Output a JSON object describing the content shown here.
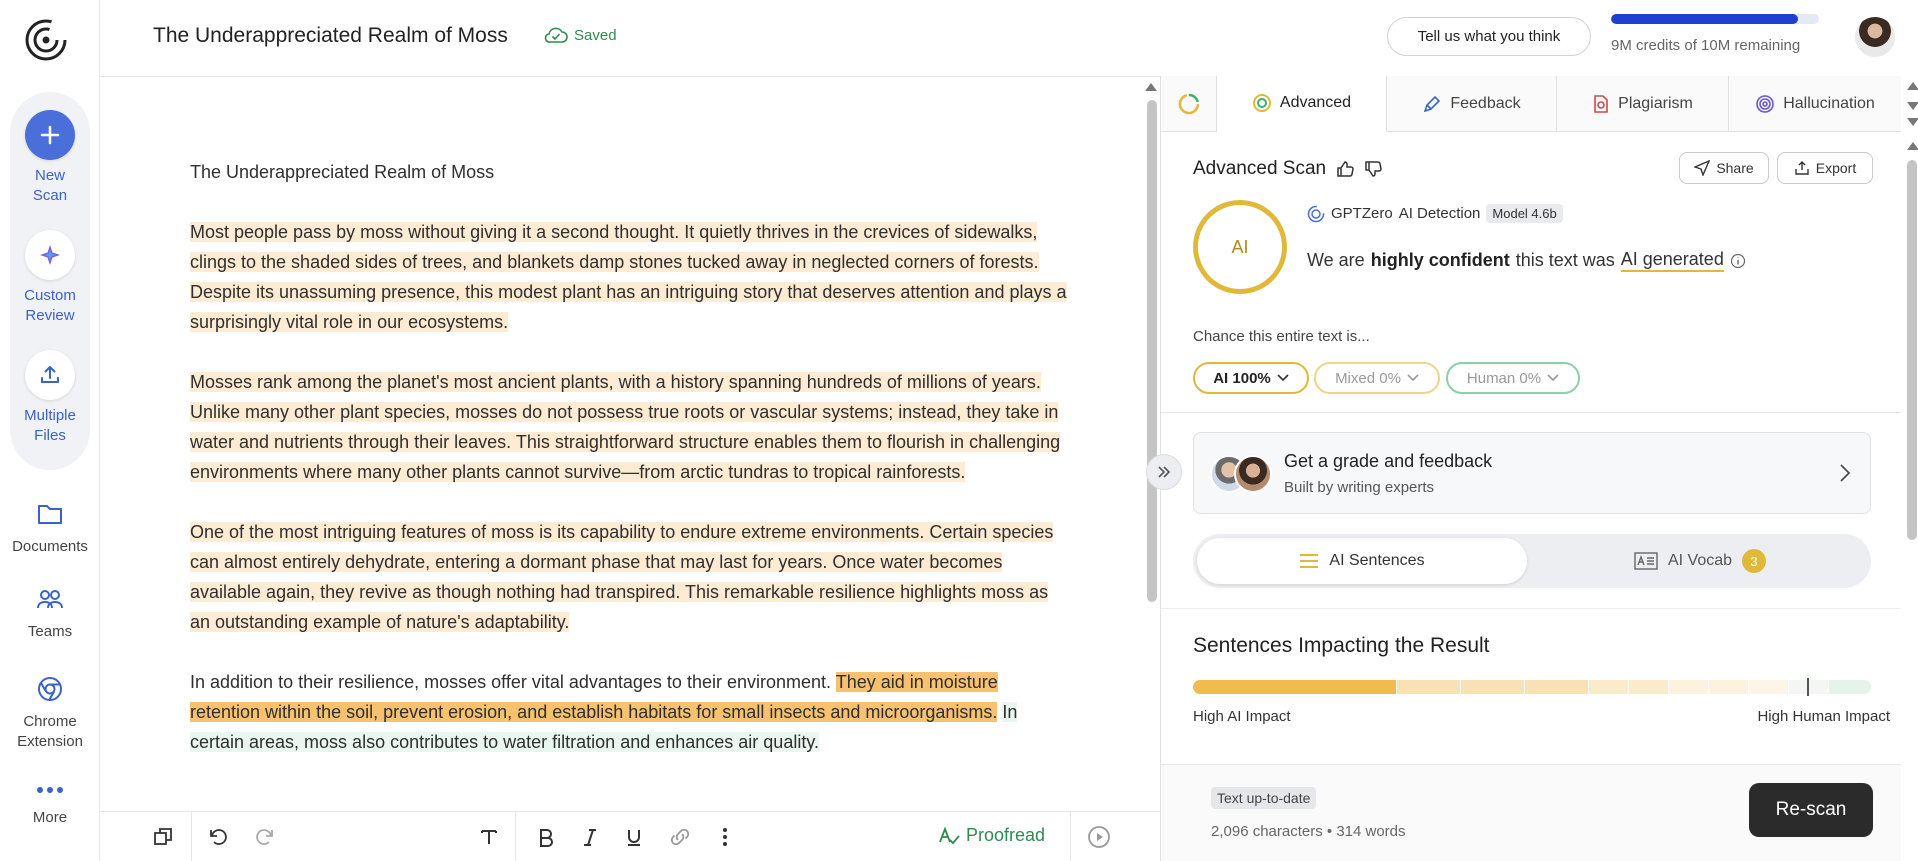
{
  "sidebar": {
    "new_scan": "New\nScan",
    "custom_review": "Custom\nReview",
    "multiple_files": "Multiple\nFiles",
    "documents": "Documents",
    "teams": "Teams",
    "chrome_extension": "Chrome\nExtension",
    "more": "More"
  },
  "header": {
    "doc_title": "The Underappreciated Realm of Moss",
    "saved": "Saved",
    "feedback_button": "Tell us what you think",
    "credits_text": "9M credits of 10M remaining",
    "credits_fraction": 0.9
  },
  "editor": {
    "title": "The Underappreciated Realm of Moss",
    "p1": [
      "Most people pass by moss without giving it a second thought.",
      " It quietly thrives in the crevices of sidewalks, clings to the shaded sides of trees, and blankets damp stones tucked away in neglected corners of forests.",
      " Despite its unassuming presence, this modest plant has an intriguing story that deserves attention and plays a surprisingly vital role in our ecosystems."
    ],
    "p2": [
      "Mosses rank among the planet's most ancient plants, with a history spanning hundreds of millions of years.",
      " Unlike many other plant species, mosses do not possess true roots or vascular systems; instead, they take in water and nutrients through their leaves.",
      " This straightforward structure enables them to flourish in challenging environments where many other plants cannot survive—from arctic tundras to tropical rainforests."
    ],
    "p3": [
      "One of the most intriguing features of moss is its capability to endure extreme environments.",
      " Certain species can almost entirely dehydrate, entering a dormant phase that may last for years.",
      " Once water becomes available again, they revive as though nothing had transpired.",
      " This remarkable resilience highlights moss as an outstanding example of nature's adaptability."
    ],
    "p4": [
      "In addition to their resilience, mosses offer vital advantages to their environment. ",
      "They aid in moisture retention within the soil, prevent erosion, and establish habitats for small insects and microorganisms.",
      " ",
      "In certain areas, moss also contributes to water filtration and enhances air quality."
    ]
  },
  "toolbar": {
    "proofread": "Proofread"
  },
  "panel": {
    "tabs": [
      "Advanced",
      "Feedback",
      "Plagiarism",
      "Hallucination"
    ],
    "advanced_title": "Advanced Scan",
    "share": "Share",
    "export": "Export",
    "ring_label": "AI",
    "detector_brand": "GPTZero",
    "detector_name": "AI Detection",
    "model": "Model 4.6b",
    "verdict_pre": "We are",
    "verdict_confidence": "highly confident",
    "verdict_mid": "this text was",
    "verdict_result": "AI generated",
    "chance_label": "Chance this entire text is...",
    "chips": [
      "AI 100%",
      "Mixed 0%",
      "Human 0%"
    ],
    "grade_title": "Get a grade and feedback",
    "grade_sub": "Built by writing experts",
    "seg_sentences": "AI Sentences",
    "seg_vocab": "AI Vocab",
    "vocab_count": "3",
    "impact_title": "Sentences Impacting the Result",
    "impact_left": "High AI Impact",
    "impact_right": "High Human Impact",
    "impact_marker_fraction": 0.905,
    "status": "Text up-to-date",
    "counts": "2,096 characters • 314 words",
    "rescan": "Re-scan"
  },
  "colors": {
    "accent_blue": "#4a6fd8",
    "ai_yellow": "#e1b93a",
    "ai_highlight": "#fdebd3",
    "ai_strong_highlight": "#f6c270",
    "human_highlight": "#e9f7f0",
    "saved_green": "#2f8a50"
  }
}
